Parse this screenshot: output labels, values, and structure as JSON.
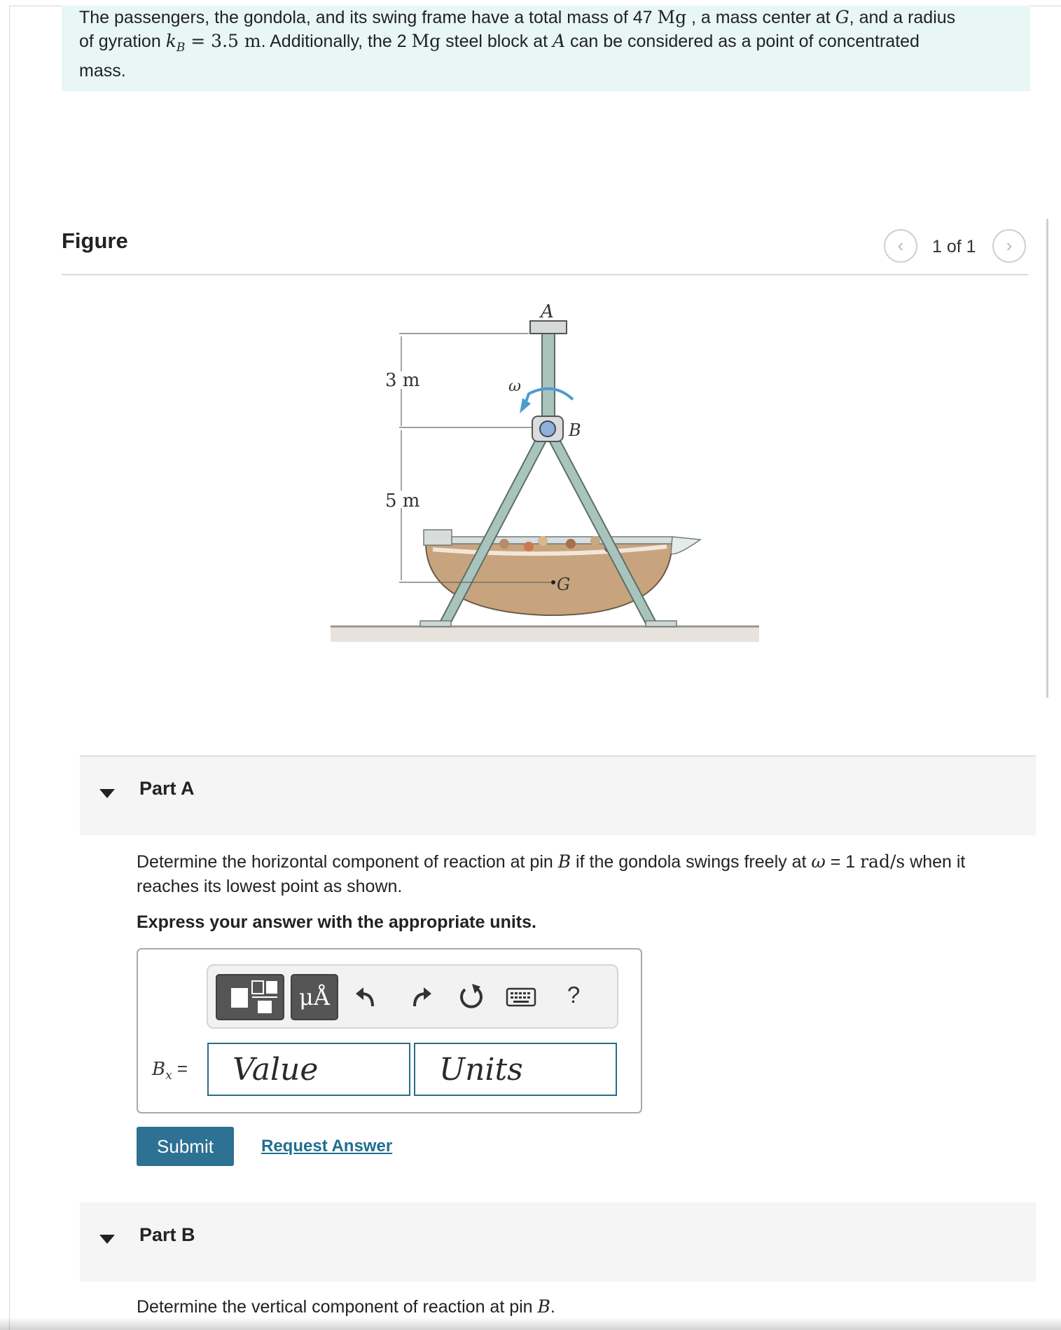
{
  "intro": {
    "line1_pre": "The passengers, the gondola, and its swing frame have a total mass of 47 ",
    "line1_unit": "Mg",
    "line1_mid": " , a mass center at ",
    "line1_G": "G",
    "line1_post": ", and a radius",
    "line2_pre": "of gyration ",
    "line2_k": "k",
    "line2_sub": "B",
    "line2_val": " = 3.5 m",
    "line2_mid": ". Additionally, the 2 ",
    "line2_unit": "Mg",
    "line2_mid2": " steel block at ",
    "line2_A": "A",
    "line2_post": " can be considered as a point of concentrated",
    "line3": "mass."
  },
  "figure": {
    "title": "Figure",
    "pager": {
      "count": "1 of 1"
    },
    "labels": {
      "A": "A",
      "B": "B",
      "G": "G",
      "omega": "ω",
      "dim1": "3 m",
      "dim2": "5 m"
    }
  },
  "part_a": {
    "title": "Part A",
    "q_pre": "Determine the horizontal component of reaction at pin ",
    "q_B": "B",
    "q_mid": " if the gondola swings freely at ",
    "q_omega": "ω",
    "q_eq": " = 1 ",
    "q_unit": "rad/s",
    "q_post": " when it",
    "q_line2": "reaches its lowest point as shown.",
    "express": "Express your answer with the appropriate units.",
    "answer": {
      "label_var": "B",
      "label_sub": "x",
      "label_eq": " =",
      "value_placeholder": "Value",
      "units_placeholder": "Units",
      "units_button": "μÅ",
      "help": "?"
    },
    "submit": "Submit",
    "request": "Request Answer"
  },
  "part_b": {
    "title": "Part B",
    "q_pre": "Determine the vertical component of reaction at pin ",
    "q_B": "B",
    "q_post": "."
  },
  "colors": {
    "accent": "#2d7193",
    "intro_bg": "#e8f6f6",
    "part_bg": "#f5f5f5",
    "frame": "#a9c4bd"
  }
}
